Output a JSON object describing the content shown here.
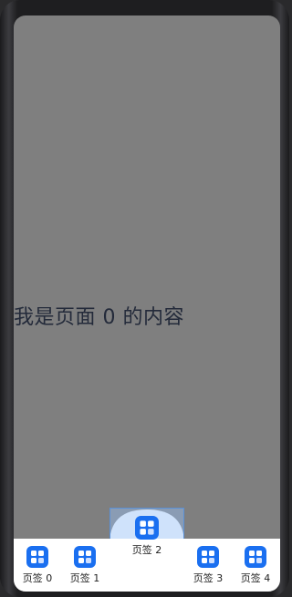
{
  "page": {
    "content_text": "我是页面 0 的内容"
  },
  "tabs": [
    {
      "label": "页签 0",
      "icon": "grid-app-icon"
    },
    {
      "label": "页签 1",
      "icon": "grid-app-icon"
    },
    {
      "label": "页签 2",
      "icon": "grid-app-icon",
      "selected": true
    },
    {
      "label": "页签 3",
      "icon": "grid-app-icon"
    },
    {
      "label": "页签 4",
      "icon": "grid-app-icon"
    }
  ],
  "colors": {
    "page_background": "#7f7f7f",
    "tabbar_background": "#ffffff",
    "icon_blue": "#1a6ff0",
    "center_highlight": "#cfe2fb",
    "center_highlight_border": "#5a90d6",
    "content_text": "#232a3a"
  }
}
